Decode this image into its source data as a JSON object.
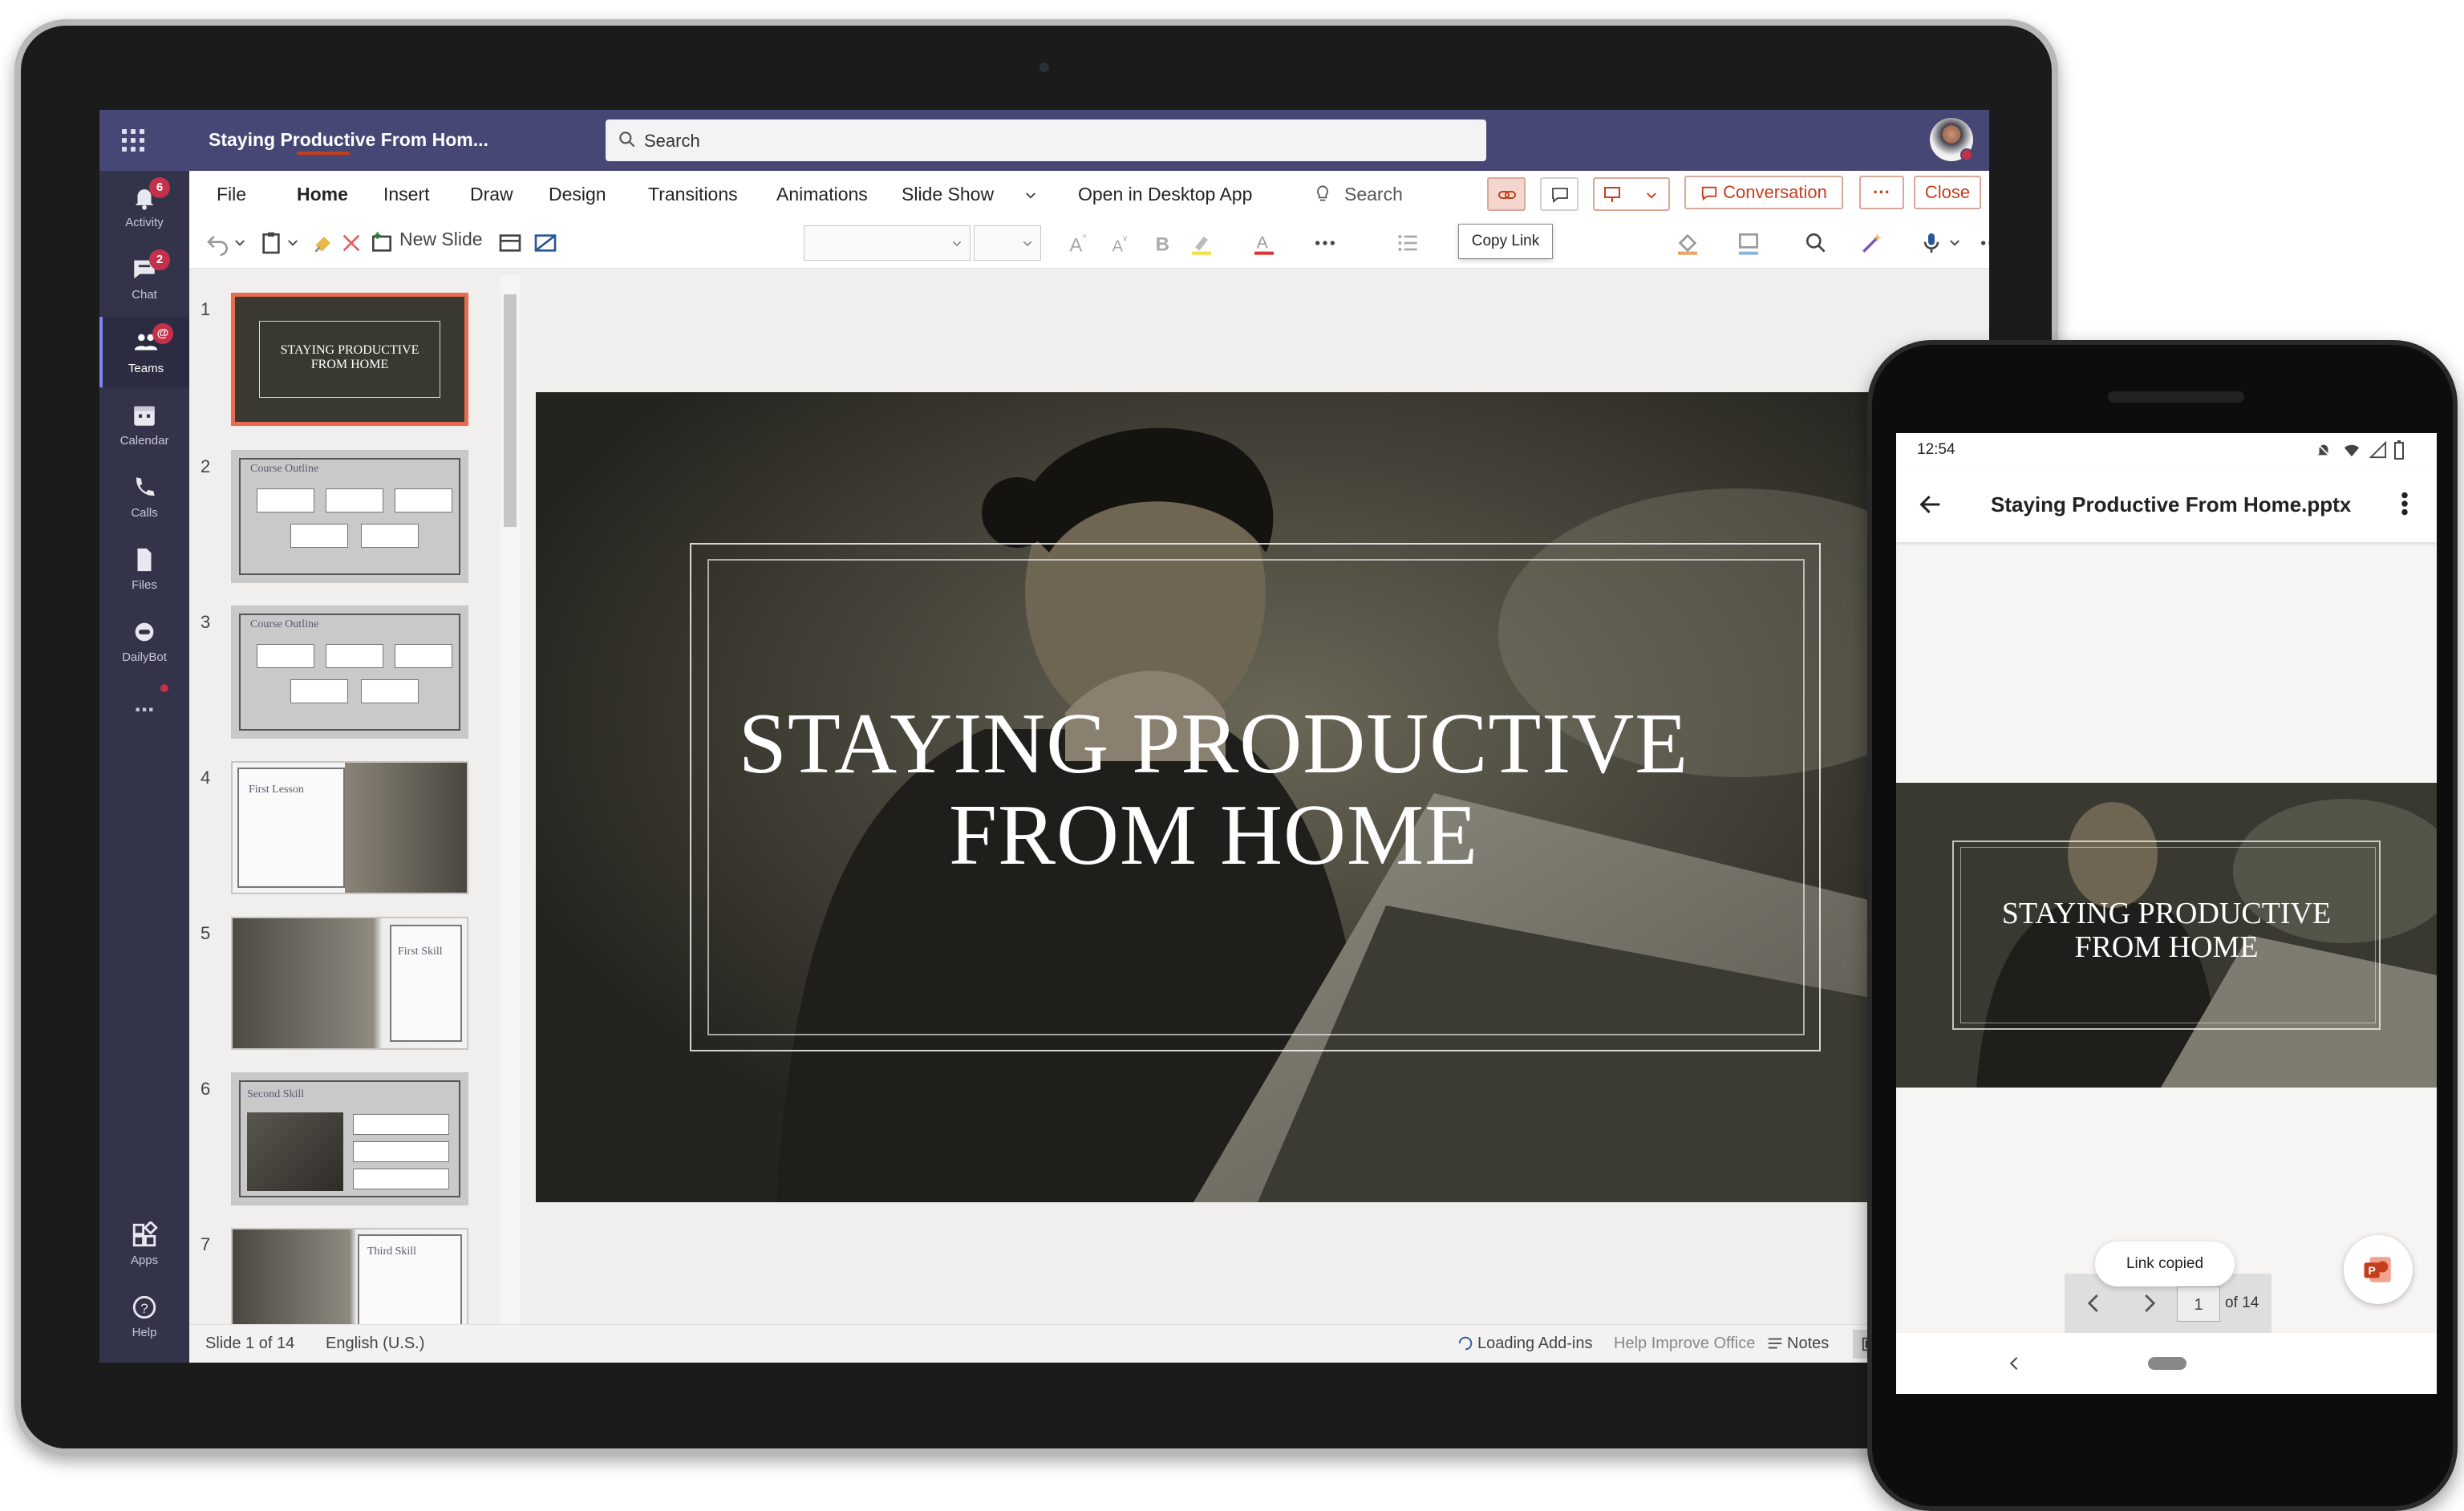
{
  "teams": {
    "document_title": "Staying Productive From Hom...",
    "search_placeholder": "Search",
    "rail": [
      {
        "label": "Activity",
        "badge": "6"
      },
      {
        "label": "Chat",
        "badge": "2"
      },
      {
        "label": "Teams",
        "badge": "@"
      },
      {
        "label": "Calendar"
      },
      {
        "label": "Calls"
      },
      {
        "label": "Files"
      },
      {
        "label": "DailyBot"
      },
      {
        "label": "..."
      },
      {
        "label": "Apps"
      },
      {
        "label": "Help"
      }
    ]
  },
  "ppt": {
    "menu": [
      "File",
      "Home",
      "Insert",
      "Draw",
      "Design",
      "Transitions",
      "Animations",
      "Slide Show",
      "Open in Desktop App",
      "Search"
    ],
    "active_tab": "Home",
    "ribbon": {
      "new_slide": "New Slide"
    },
    "buttons": {
      "conversation": "Conversation",
      "more": "···",
      "close": "Close"
    },
    "tooltip": "Copy Link",
    "thumbnails": [
      {
        "num": "1",
        "title": "STAYING PRODUCTIVE FROM HOME"
      },
      {
        "num": "2",
        "title": "Course Outline"
      },
      {
        "num": "3",
        "title": "Course Outline"
      },
      {
        "num": "4",
        "title": "First Lesson"
      },
      {
        "num": "5",
        "title": "First Skill"
      },
      {
        "num": "6",
        "title": "Second Skill"
      },
      {
        "num": "7",
        "title": "Third Skill"
      }
    ],
    "slide_title_line1": "STAYING PRODUCTIVE",
    "slide_title_line2": "FROM HOME",
    "status": {
      "slide_of": "Slide 1 of 14",
      "language": "English (U.S.)",
      "addins": "Loading Add-ins",
      "improve": "Help Improve Office",
      "notes": "Notes"
    }
  },
  "phone": {
    "time": "12:54",
    "title": "Staying Productive From Home.pptx",
    "slide_title_line1": "STAYING PRODUCTIVE",
    "slide_title_line2": "FROM HOME",
    "toast": "Link copied",
    "page_value": "1",
    "page_of": "of 14"
  },
  "colors": {
    "teams_purple": "#464775",
    "ppt_accent": "#c43e1c",
    "alert_red": "#c4314b"
  }
}
